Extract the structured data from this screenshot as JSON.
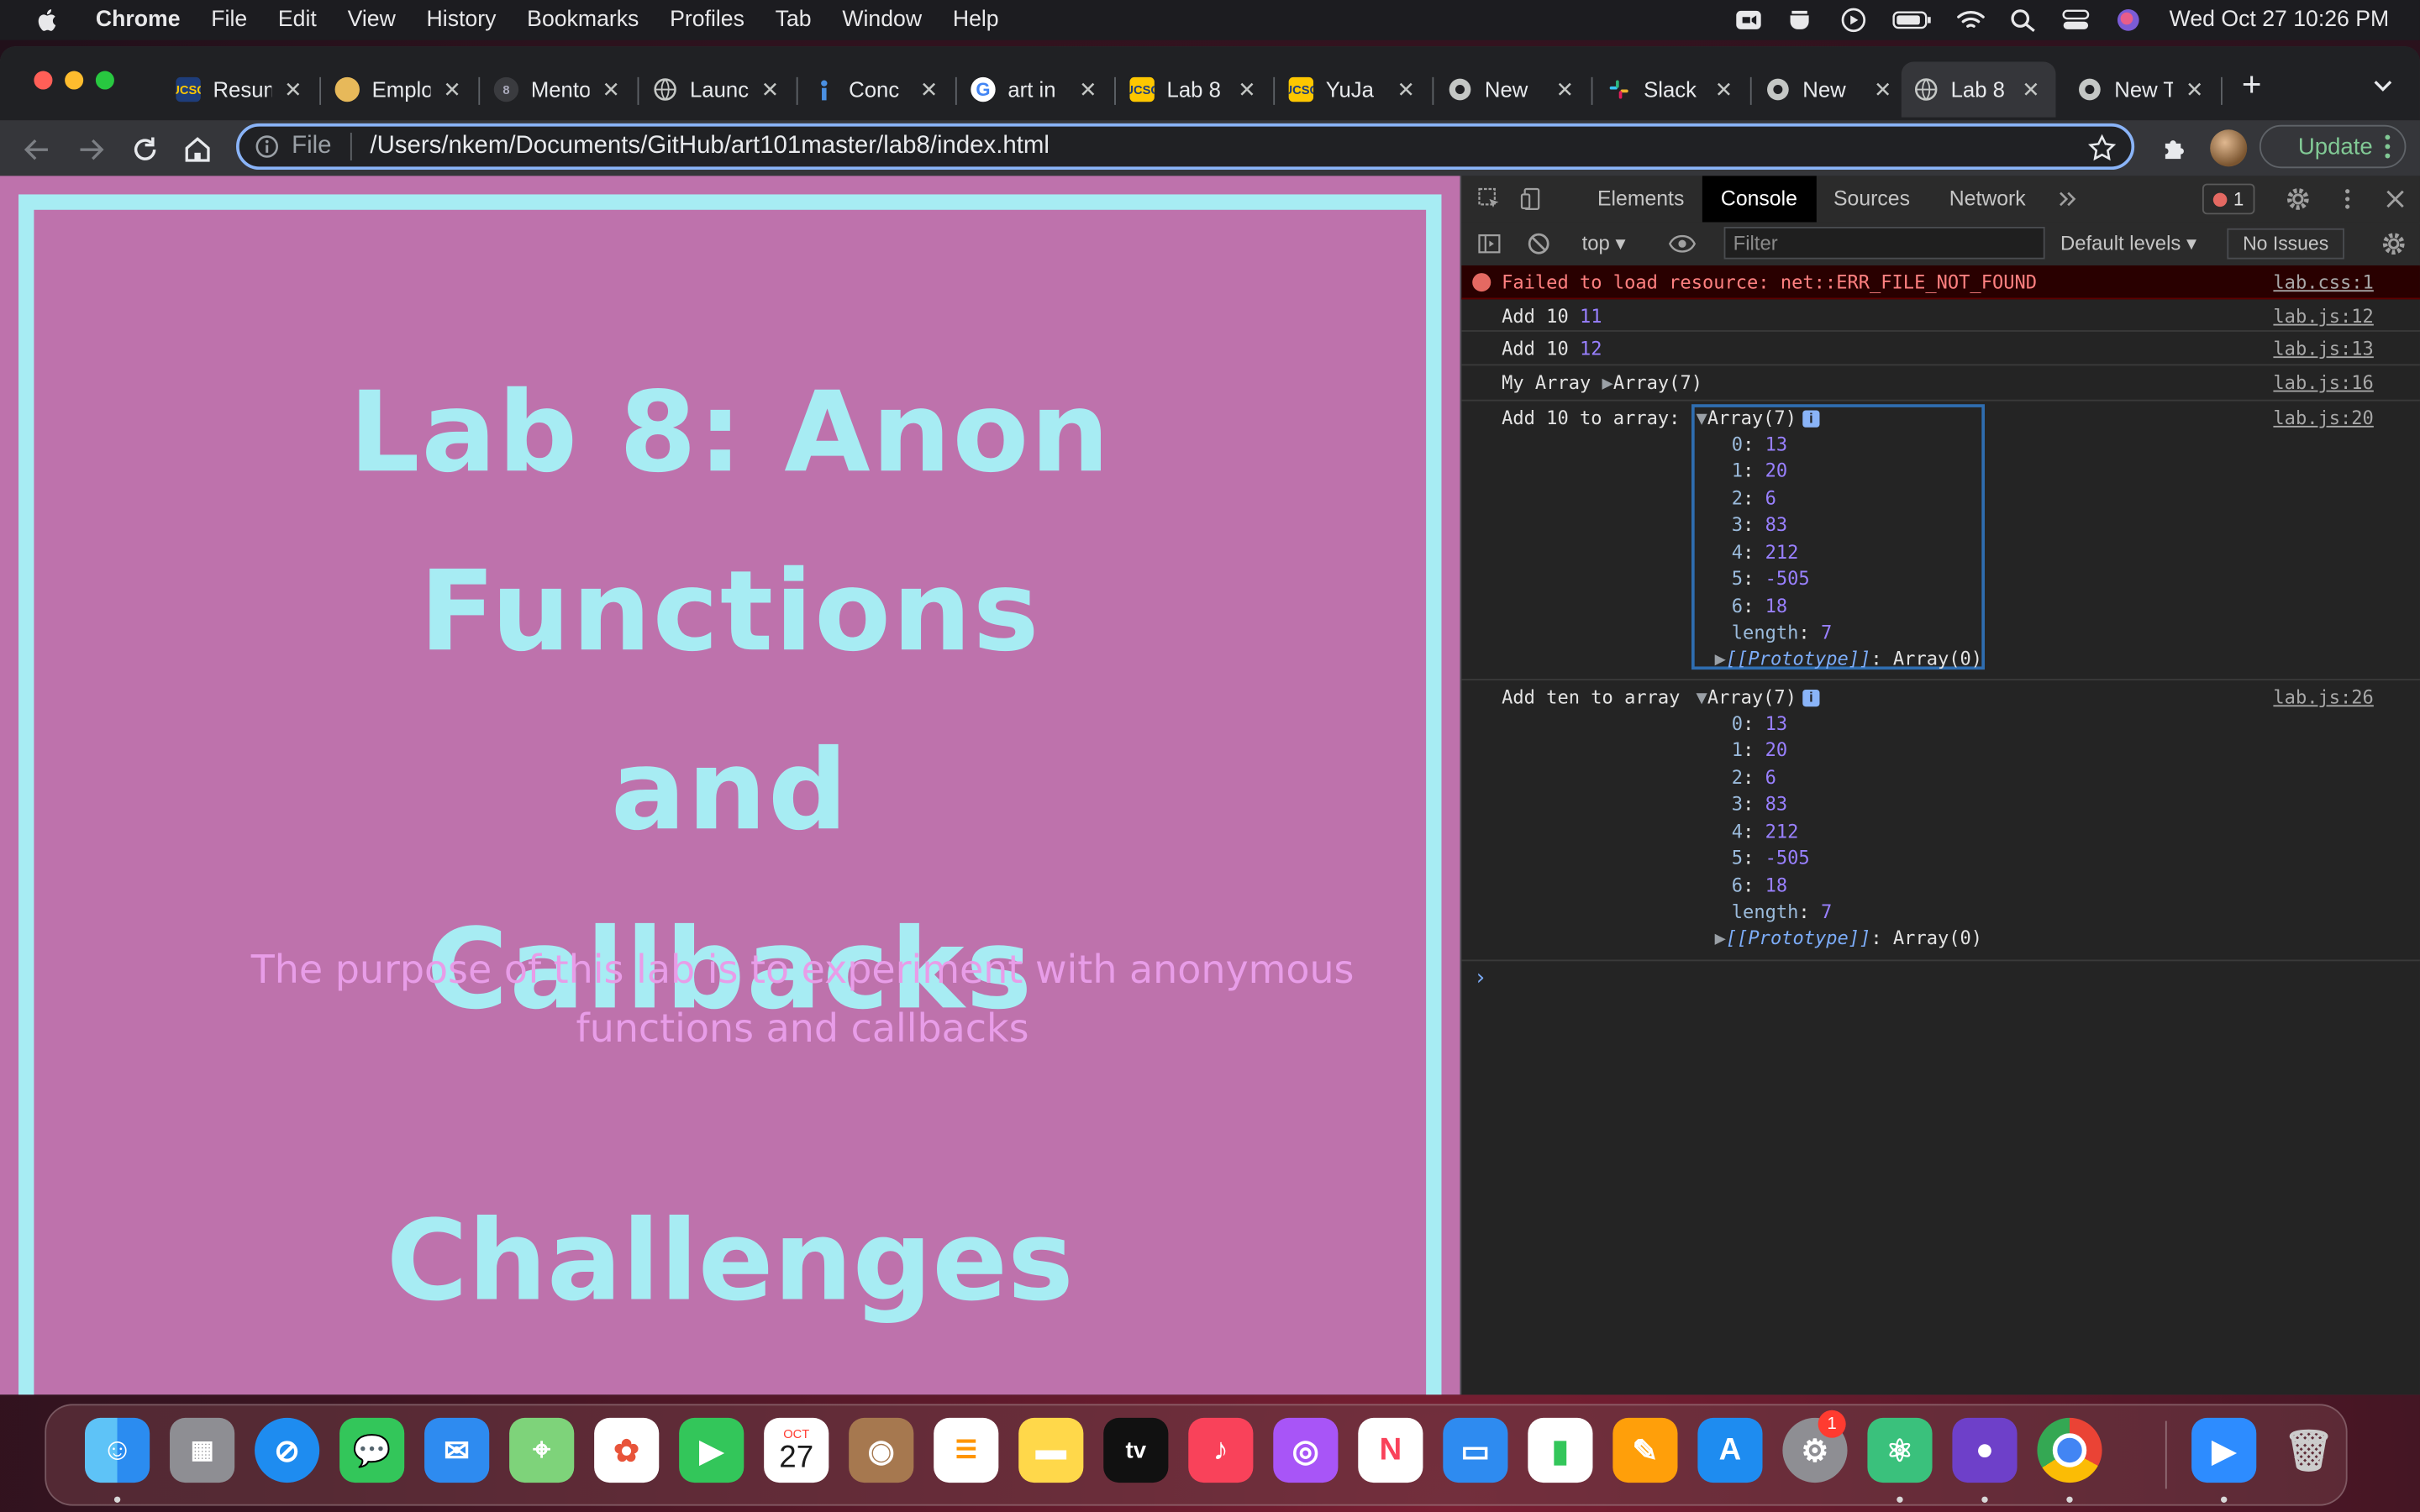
{
  "menubar": {
    "app": "Chrome",
    "menus": [
      "File",
      "Edit",
      "View",
      "History",
      "Bookmarks",
      "Profiles",
      "Tab",
      "Window",
      "Help"
    ],
    "clock": "Wed Oct 27  10:26 PM"
  },
  "tabs": [
    {
      "title": "Resum",
      "favicon": "UCSC"
    },
    {
      "title": "Emplo",
      "favicon": ""
    },
    {
      "title": "Mento",
      "favicon": "8"
    },
    {
      "title": "Launc",
      "favicon": ""
    },
    {
      "title": "Conc",
      "favicon": ""
    },
    {
      "title": "art in",
      "favicon": "G"
    },
    {
      "title": "Lab 8",
      "favicon": "UCSC"
    },
    {
      "title": "YuJa",
      "favicon": "UCSC"
    },
    {
      "title": "New",
      "favicon": ""
    },
    {
      "title": "Slack",
      "favicon": ""
    },
    {
      "title": "New",
      "favicon": ""
    },
    {
      "title": "Lab 8",
      "favicon": ""
    },
    {
      "title": "New T",
      "favicon": ""
    }
  ],
  "tab_close": "✕",
  "omnibox": {
    "scheme": "File",
    "url": "/Users/nkem/Documents/GitHub/art101master/lab8/index.html"
  },
  "toolbar": {
    "update_label": "Update"
  },
  "page": {
    "heading": "Lab 8: Anon Functions and Callbacks",
    "purpose": "The purpose of this lab is to experiment with anonymous functions and callbacks",
    "section_heading": "Challenges"
  },
  "devtools": {
    "tabs": [
      "Elements",
      "Console",
      "Sources",
      "Network"
    ],
    "active_tab": "Console",
    "error_count": "1",
    "context": "top",
    "filter_placeholder": "Filter",
    "levels": "Default levels",
    "issues": "No Issues",
    "messages": [
      {
        "text": "Failed to load resource: net::ERR_FILE_NOT_FOUND",
        "source": "lab.css:1"
      },
      {
        "label": "Add 10",
        "value": "11",
        "source": "lab.js:12"
      },
      {
        "label": "Add 10",
        "value": "12",
        "source": "lab.js:13"
      },
      {
        "label": "My Array",
        "value": "Array(7)",
        "source": "lab.js:16"
      },
      {
        "label": "Add 10 to array:",
        "value": "Array(7)",
        "source": "lab.js:20"
      },
      {
        "label": "Add ten to array",
        "value": "Array(7)",
        "source": "lab.js:26"
      }
    ],
    "array_items": [
      "13",
      "20",
      "6",
      "83",
      "212",
      "-505",
      "18"
    ],
    "array_length": "7",
    "prototype_label": "[[Prototype]]",
    "prototype_value": "Array(0)"
  },
  "dock": {
    "calendar_month": "OCT",
    "calendar_day": "27",
    "settings_badge": "1"
  }
}
